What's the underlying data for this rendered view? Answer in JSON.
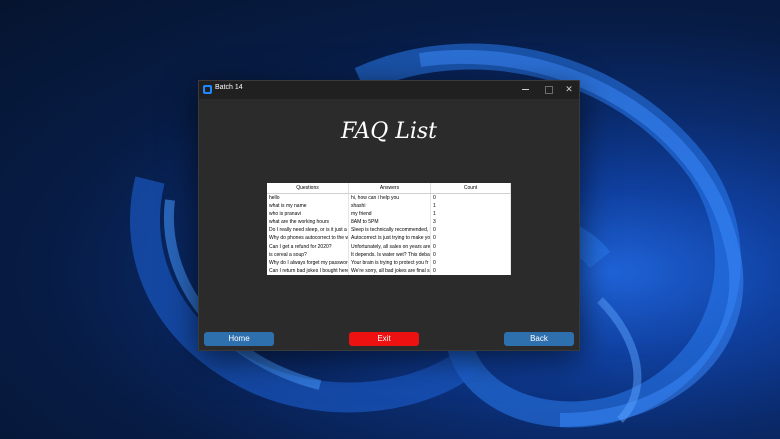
{
  "window": {
    "title": "Batch 14"
  },
  "page": {
    "heading": "FAQ List"
  },
  "table": {
    "headers": [
      "Questions",
      "Answers",
      "Count"
    ],
    "rows": [
      [
        "hello",
        "hi, how can i help you",
        "0"
      ],
      [
        "what is my name",
        "shashi",
        "1"
      ],
      [
        "who is pranavi",
        "my friend",
        "1"
      ],
      [
        "what are the working hours",
        "8AM to 5PM",
        "3"
      ],
      [
        "Do I really need sleep, or is it just a su",
        "Sleep is technically recommended, b",
        "0"
      ],
      [
        "Why do phones autocorrect to the w",
        "Autocorrect is just trying to make yo",
        "0"
      ],
      [
        "Can I get a refund for 2020?",
        "Unfortunately, all sales on years are f",
        "0"
      ],
      [
        "is cereal a soup?",
        "It depends. Is water wet? This debate",
        "0"
      ],
      [
        "Why do I always forget my password",
        "Your brain is trying to protect you fr",
        "0"
      ],
      [
        "Can I return bad jokes I bought here?",
        "We're sorry, all bad jokes are final sal",
        "0"
      ]
    ]
  },
  "buttons": {
    "home": "Home",
    "exit": "Exit",
    "back": "Back"
  },
  "colors": {
    "accent": "#2e6fad",
    "exit": "#ee1111"
  }
}
